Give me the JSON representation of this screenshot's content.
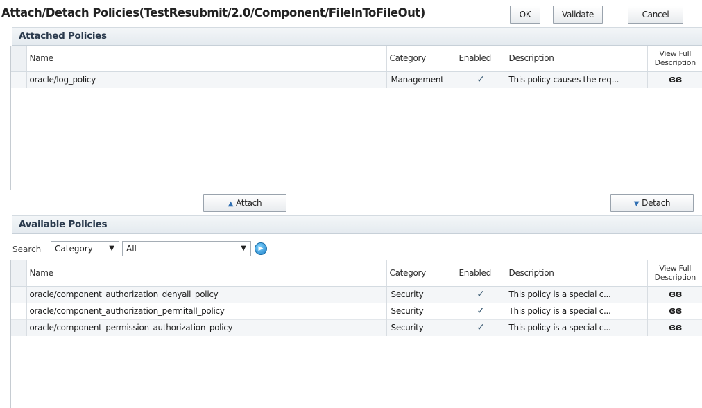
{
  "header": {
    "title": "Attach/Detach Policies(TestResubmit/2.0/Component/FileInToFileOut)",
    "ok_label": "OK",
    "validate_label": "Validate",
    "cancel_label": "Cancel"
  },
  "attached": {
    "title": "Attached Policies",
    "columns": {
      "name": "Name",
      "category": "Category",
      "enabled": "Enabled",
      "description": "Description",
      "view_full": "View Full Description"
    },
    "rows": [
      {
        "name": "oracle/log_policy",
        "category": "Management",
        "enabled": "✓",
        "description": "This policy causes the req...",
        "view": "ɞɞ"
      }
    ]
  },
  "actions": {
    "attach_label": "Attach",
    "detach_label": "Detach"
  },
  "available": {
    "title": "Available Policies",
    "search": {
      "label": "Search",
      "field_value": "Category",
      "filter_value": "All"
    },
    "columns": {
      "name": "Name",
      "category": "Category",
      "enabled": "Enabled",
      "description": "Description",
      "view_full": "View Full Description"
    },
    "rows": [
      {
        "name": "oracle/component_authorization_denyall_policy",
        "category": "Security",
        "enabled": "✓",
        "description": "This policy is a special c...",
        "view": "ɞɞ"
      },
      {
        "name": "oracle/component_authorization_permitall_policy",
        "category": "Security",
        "enabled": "✓",
        "description": "This policy is a special c...",
        "view": "ɞɞ"
      },
      {
        "name": "oracle/component_permission_authorization_policy",
        "category": "Security",
        "enabled": "✓",
        "description": "This policy is a special c...",
        "view": "ɞɞ"
      }
    ]
  },
  "icons": {
    "attach": "triangle-up-icon",
    "detach": "triangle-down-icon",
    "go": "go-arrow-icon",
    "view": "glasses-icon",
    "enabled": "checkmark-icon"
  },
  "colors": {
    "accent": "#2f6fb3",
    "panel_header": "#e4eaef"
  }
}
